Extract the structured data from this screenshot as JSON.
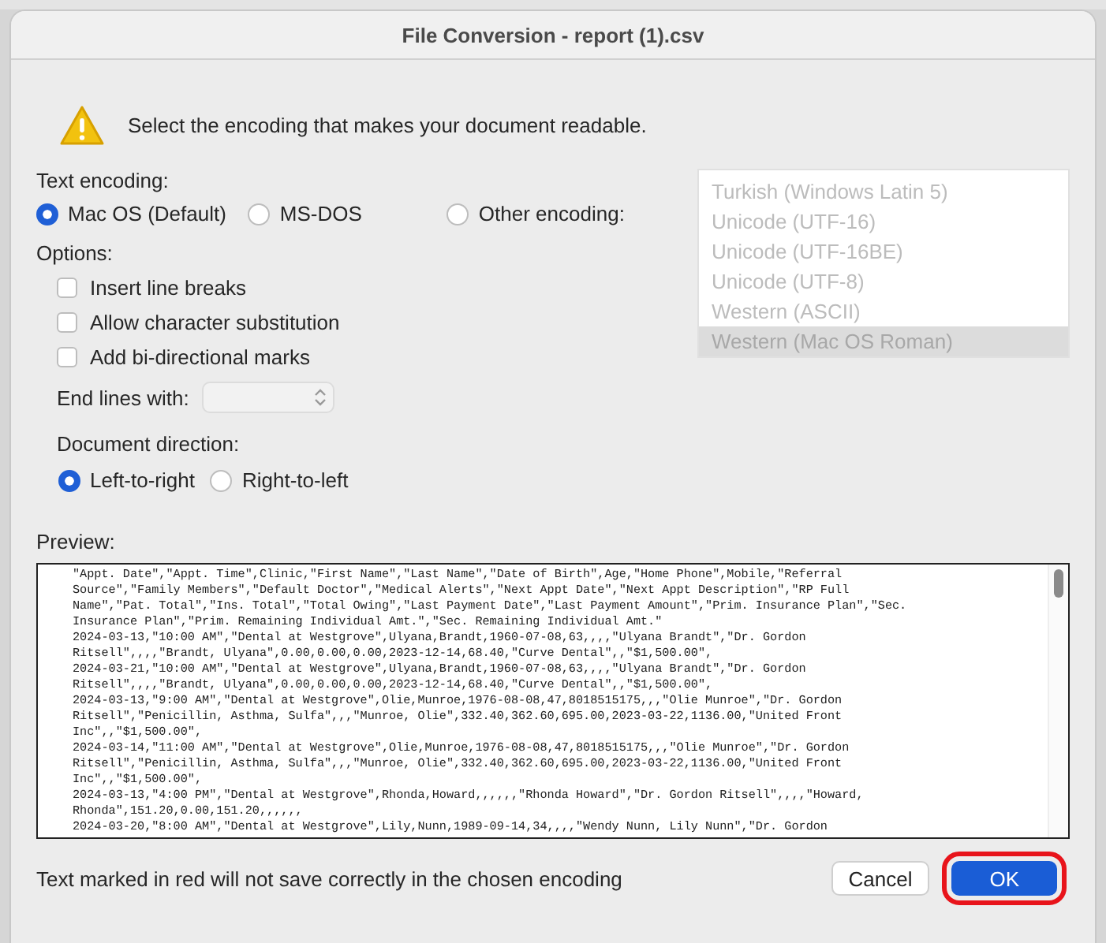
{
  "window": {
    "title": "File Conversion - report (1).csv"
  },
  "message": "Select the encoding that makes your document readable.",
  "text_encoding": {
    "label": "Text encoding:",
    "options": [
      {
        "label": "Mac OS (Default)",
        "selected": true
      },
      {
        "label": "MS-DOS",
        "selected": false
      },
      {
        "label": "Other encoding:",
        "selected": false
      }
    ],
    "list": [
      {
        "label": "Turkish (Windows Latin 5)",
        "selected": false
      },
      {
        "label": "Unicode (UTF-16)",
        "selected": false
      },
      {
        "label": "Unicode (UTF-16BE)",
        "selected": false
      },
      {
        "label": "Unicode (UTF-8)",
        "selected": false
      },
      {
        "label": "Western (ASCII)",
        "selected": false
      },
      {
        "label": "Western (Mac OS Roman)",
        "selected": true
      }
    ]
  },
  "options": {
    "label": "Options:",
    "checkboxes": [
      {
        "label": "Insert line breaks",
        "checked": false
      },
      {
        "label": "Allow character substitution",
        "checked": false
      },
      {
        "label": "Add bi-directional marks",
        "checked": false
      }
    ],
    "end_lines": {
      "label": "End lines with:",
      "disabled": true
    }
  },
  "direction": {
    "label": "Document direction:",
    "options": [
      {
        "label": "Left-to-right",
        "selected": true
      },
      {
        "label": "Right-to-left",
        "selected": false
      }
    ]
  },
  "preview": {
    "label": "Preview:",
    "lines": [
      "\"Appt. Date\",\"Appt. Time\",Clinic,\"First Name\",\"Last Name\",\"Date of Birth\",Age,\"Home Phone\",Mobile,\"Referral",
      "Source\",\"Family Members\",\"Default Doctor\",\"Medical Alerts\",\"Next Appt Date\",\"Next Appt Description\",\"RP Full",
      "Name\",\"Pat. Total\",\"Ins. Total\",\"Total Owing\",\"Last Payment Date\",\"Last Payment Amount\",\"Prim. Insurance Plan\",\"Sec.",
      "Insurance Plan\",\"Prim. Remaining Individual Amt.\",\"Sec. Remaining Individual Amt.\"",
      "2024-03-13,\"10:00 AM\",\"Dental at Westgrove\",Ulyana,Brandt,1960-07-08,63,,,,\"Ulyana Brandt\",\"Dr. Gordon",
      "Ritsell\",,,,\"Brandt, Ulyana\",0.00,0.00,0.00,2023-12-14,68.40,\"Curve Dental\",,\"$1,500.00\",",
      "2024-03-21,\"10:00 AM\",\"Dental at Westgrove\",Ulyana,Brandt,1960-07-08,63,,,,\"Ulyana Brandt\",\"Dr. Gordon",
      "Ritsell\",,,,\"Brandt, Ulyana\",0.00,0.00,0.00,2023-12-14,68.40,\"Curve Dental\",,\"$1,500.00\",",
      "2024-03-13,\"9:00 AM\",\"Dental at Westgrove\",Olie,Munroe,1976-08-08,47,8018515175,,,\"Olie Munroe\",\"Dr. Gordon",
      "Ritsell\",\"Penicillin, Asthma, Sulfa\",,,\"Munroe, Olie\",332.40,362.60,695.00,2023-03-22,1136.00,\"United Front",
      "Inc\",,\"$1,500.00\",",
      "2024-03-14,\"11:00 AM\",\"Dental at Westgrove\",Olie,Munroe,1976-08-08,47,8018515175,,,\"Olie Munroe\",\"Dr. Gordon",
      "Ritsell\",\"Penicillin, Asthma, Sulfa\",,,\"Munroe, Olie\",332.40,362.60,695.00,2023-03-22,1136.00,\"United Front",
      "Inc\",,\"$1,500.00\",",
      "2024-03-13,\"4:00 PM\",\"Dental at Westgrove\",Rhonda,Howard,,,,,,\"Rhonda Howard\",\"Dr. Gordon Ritsell\",,,,\"Howard,",
      "Rhonda\",151.20,0.00,151.20,,,,,,",
      "2024-03-20,\"8:00 AM\",\"Dental at Westgrove\",Lily,Nunn,1989-09-14,34,,,,\"Wendy Nunn, Lily Nunn\",\"Dr. Gordon"
    ]
  },
  "footer_note": "Text marked in red will not save correctly in the chosen encoding",
  "buttons": [
    {
      "label": "Cancel",
      "kind": "normal"
    },
    {
      "label": "OK",
      "kind": "default"
    }
  ]
}
